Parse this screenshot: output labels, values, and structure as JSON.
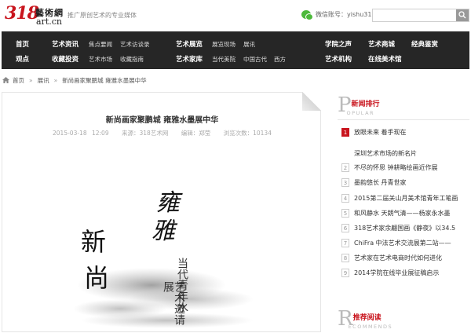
{
  "header": {
    "logo_num": "318",
    "logo_cn": "藝術網",
    "logo_en": "art.cn",
    "slogan": "推广原创艺术的专业媒体",
    "wechat": "微信账号：yishu318",
    "search_placeholder": ""
  },
  "nav": {
    "row1": [
      "首页",
      "艺术资讯",
      "焦点要闻",
      "艺术访谈录",
      "艺术展览",
      "展览现场",
      "展讯",
      "学院之声",
      "艺术商城",
      "经典鉴赏"
    ],
    "row2": [
      "观点",
      "收藏投资",
      "艺术市场",
      "收藏指南",
      "艺术家库",
      "当代美院",
      "中国古代",
      "西方",
      "艺术机构",
      "在线美术馆"
    ]
  },
  "breadcrumb": {
    "home": "首页",
    "section": "展讯",
    "current": "新尚画家聚鹏城 雍雅水墨展中华"
  },
  "article": {
    "title": "新尚画家聚鹏城 雍雅水墨展中华",
    "date": "2015-03-18 12:09",
    "source": "来源：318艺术网",
    "editor": "编辑：郑莹",
    "views": "浏览次数：10134",
    "poster_chars": [
      "新",
      "尚"
    ],
    "poster_chars2": [
      "雍",
      "雅"
    ],
    "poster_sub1": "当代青年水",
    "poster_sub2": "艺术邀请展"
  },
  "sidebar": {
    "news_rank": {
      "letter": "P",
      "title": "新闻排行",
      "sub": "OPULAR",
      "items": [
        {
          "num": "1",
          "text": "放眼未来 着手现在",
          "hot": true
        },
        {
          "num": "",
          "text": "深圳艺术市场的新名片",
          "hot": false
        },
        {
          "num": "2",
          "text": "不尽的怀思 钟耕略绘画近作展",
          "hot": false
        },
        {
          "num": "3",
          "text": "墨韵悠长 丹青世家",
          "hot": false
        },
        {
          "num": "4",
          "text": "2015第二届关山月美术馆青年工笔画",
          "hot": false
        },
        {
          "num": "5",
          "text": "和风静水 天朗气清——杨家永水墨",
          "hot": false
        },
        {
          "num": "6",
          "text": "318艺术家余翩国画《静夜》以34.5",
          "hot": false
        },
        {
          "num": "7",
          "text": "ChiFra 中法艺术交流展第二站——",
          "hot": false
        },
        {
          "num": "8",
          "text": "艺术家在艺术电商时代如何进化",
          "hot": false
        },
        {
          "num": "9",
          "text": "2014学院在线毕业展征稿启示",
          "hot": false
        }
      ]
    },
    "recommend": {
      "letter": "R",
      "title": "推荐阅读",
      "sub": "ECOMMENDS"
    }
  },
  "colors": {
    "brand_red": "#c9151e",
    "nav_bg": "#262626"
  }
}
